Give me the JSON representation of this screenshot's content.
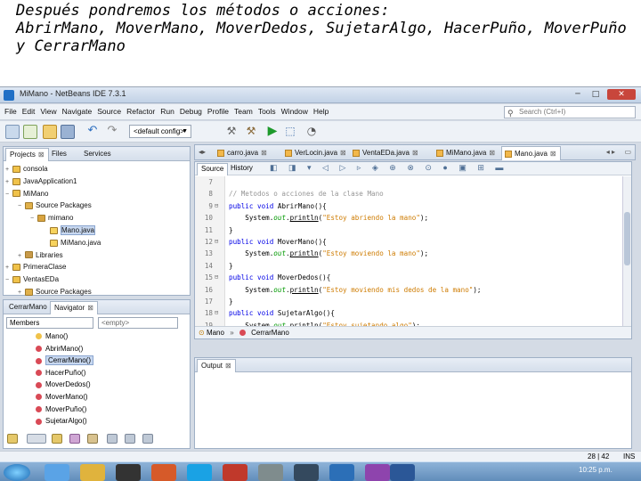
{
  "caption": {
    "line1": "Después pondremos los métodos o acciones:",
    "line2": "AbrirMano, MoverMano, MoverDedos, SujetarAlgo, HacerPuño, MoverPuño",
    "line3": "y CerrarMano"
  },
  "window": {
    "title": "MiMano - NetBeans IDE 7.3.1",
    "min": "─",
    "max": "□",
    "close": "✕"
  },
  "menu": [
    "File",
    "Edit",
    "View",
    "Navigate",
    "Source",
    "Refactor",
    "Run",
    "Debug",
    "Profile",
    "Team",
    "Tools",
    "Window",
    "Help"
  ],
  "search": {
    "placeholder": "Search (Ctrl+I)"
  },
  "toolbar": {
    "config": "<default config>"
  },
  "projects_panel": {
    "tabs": [
      "Projects",
      "Files",
      "Services"
    ],
    "tree": [
      {
        "label": "consola",
        "level": 0,
        "expander": "+"
      },
      {
        "label": "JavaApplication1",
        "level": 0,
        "expander": "+"
      },
      {
        "label": "MiMano",
        "level": 0,
        "expander": "−"
      },
      {
        "label": "Source Packages",
        "level": 1,
        "expander": "−"
      },
      {
        "label": "mimano",
        "level": 2,
        "expander": "−"
      },
      {
        "label": "Mano.java",
        "level": 3,
        "expander": ""
      },
      {
        "label": "MiMano.java",
        "level": 3,
        "expander": ""
      },
      {
        "label": "Libraries",
        "level": 1,
        "expander": "+"
      },
      {
        "label": "PrimeraClase",
        "level": 0,
        "expander": "+"
      },
      {
        "label": "VentasEDa",
        "level": 0,
        "expander": "−"
      },
      {
        "label": "Source Packages",
        "level": 1,
        "expander": "+"
      }
    ]
  },
  "navigator_panel": {
    "tabs": [
      "CerrarMano",
      "Navigator"
    ],
    "members_label": "Members",
    "filter": "<empty>",
    "members": [
      "Mano()",
      "AbrirMano()",
      "CerrarMano()",
      "HacerPuño()",
      "MoverDedos()",
      "MoverMano()",
      "MoverPuño()",
      "SujetarAlgo()"
    ],
    "selected_index": 2
  },
  "editor": {
    "tabs": [
      "carro.java",
      "VerLocin.java",
      "VentaEDa.java",
      "MiMano.java",
      "Mano.java"
    ],
    "active_tab": 4,
    "source_tab": "Source",
    "history_tab": "History",
    "lines": [
      {
        "n": "7",
        "fold": "",
        "text": ""
      },
      {
        "n": "8",
        "fold": "",
        "text": "// Metodos o acciones de la clase Mano"
      },
      {
        "n": "9",
        "fold": "⊟",
        "text": "public void AbrirMano(){"
      },
      {
        "n": "10",
        "fold": "",
        "text": "    System.out.println(\"Estoy abriendo la mano\");"
      },
      {
        "n": "11",
        "fold": "",
        "text": "}"
      },
      {
        "n": "12",
        "fold": "⊟",
        "text": "public void MoverMano(){"
      },
      {
        "n": "13",
        "fold": "",
        "text": "    System.out.println(\"Estoy moviendo la mano\");"
      },
      {
        "n": "14",
        "fold": "",
        "text": "}"
      },
      {
        "n": "15",
        "fold": "⊟",
        "text": "public void MoverDedos(){"
      },
      {
        "n": "16",
        "fold": "",
        "text": "    System.out.println(\"Estoy moviendo mis dedos de la mano\");"
      },
      {
        "n": "17",
        "fold": "",
        "text": "}"
      },
      {
        "n": "18",
        "fold": "⊟",
        "text": "public void SujetarAlgo(){"
      },
      {
        "n": "19",
        "fold": "",
        "text": "    System.out.println(\"Estoy sujetando algo\");"
      }
    ],
    "breadcrumbs": [
      "Mano",
      "CerrarMano"
    ]
  },
  "output": {
    "tab": "Output"
  },
  "status": {
    "position": "28 | 42",
    "mode": "INS"
  },
  "taskbar": {
    "clock": "10:25 p.m."
  },
  "colors": {
    "keyword": "#0000e6",
    "string": "#ce7b00",
    "comment": "#969696",
    "method_dot": "#d94a56"
  }
}
